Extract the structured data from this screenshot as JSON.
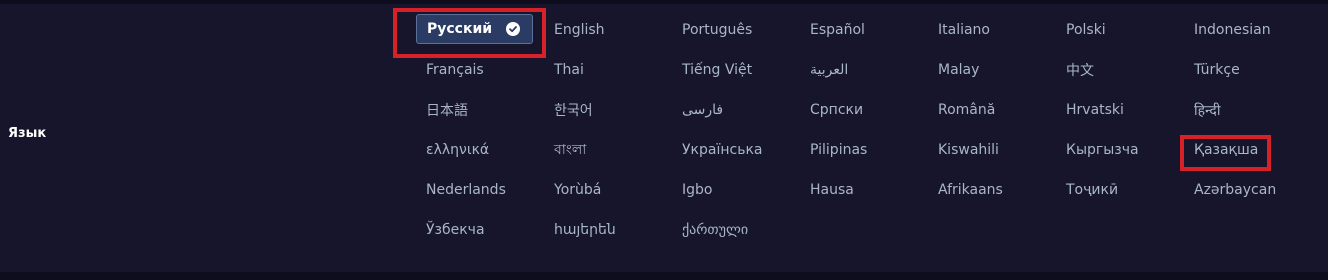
{
  "section": {
    "label": "Язык"
  },
  "languages": [
    {
      "label": "Русский",
      "selected": true
    },
    {
      "label": "English"
    },
    {
      "label": "Português"
    },
    {
      "label": "Español"
    },
    {
      "label": "Italiano"
    },
    {
      "label": "Polski"
    },
    {
      "label": "Indonesian"
    },
    {
      "label": "Français"
    },
    {
      "label": "Thai"
    },
    {
      "label": "Tiếng Việt"
    },
    {
      "label": "العربية"
    },
    {
      "label": "Malay"
    },
    {
      "label": "中文"
    },
    {
      "label": "Türkçe"
    },
    {
      "label": "日本語"
    },
    {
      "label": "한국어"
    },
    {
      "label": "فارسی"
    },
    {
      "label": "Српски"
    },
    {
      "label": "Română"
    },
    {
      "label": "Hrvatski"
    },
    {
      "label": "हिन्दी"
    },
    {
      "label": "ελληνικά"
    },
    {
      "label": "বাংলা"
    },
    {
      "label": "Українська"
    },
    {
      "label": "Pilipinas"
    },
    {
      "label": "Kiswahili"
    },
    {
      "label": "Кыргызча"
    },
    {
      "label": "Қазақша"
    },
    {
      "label": "Nederlands"
    },
    {
      "label": "Yorùbá"
    },
    {
      "label": "Igbo"
    },
    {
      "label": "Hausa"
    },
    {
      "label": "Afrikaans"
    },
    {
      "label": "Тоҷикӣ"
    },
    {
      "label": "Azərbaycan"
    },
    {
      "label": "Ўзбекча"
    },
    {
      "label": "հայերեն"
    },
    {
      "label": "ქართული"
    }
  ],
  "colors": {
    "background": "#16152b",
    "selected_bg": "#2a3c63",
    "text": "#a9b6c9",
    "highlight": "#d62128"
  }
}
